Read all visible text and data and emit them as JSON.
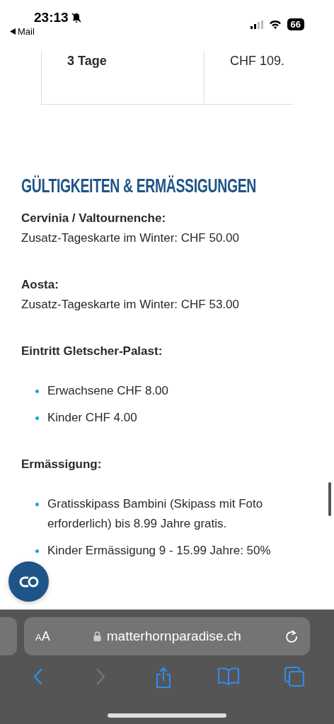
{
  "status_bar": {
    "time": "23:13",
    "back_label": "Mail",
    "battery": "66"
  },
  "table": {
    "rows": [
      {
        "cells": [
          "3 Tage",
          "CHF 109."
        ]
      }
    ]
  },
  "heading": "GÜLTIGKEITEN & ERMÄSSIGUNGEN",
  "sections": [
    {
      "title": "Cervinia / Valtournenche:",
      "kind": "text",
      "text": "Zusatz-Tageskarte im Winter: CHF 50.00"
    },
    {
      "title": "Aosta:",
      "kind": "text",
      "text": "Zusatz-Tageskarte im Winter: CHF 53.00"
    },
    {
      "title": "Eintritt Gletscher-Palast:",
      "kind": "list",
      "items": [
        "Erwachsene CHF 8.00",
        "Kinder CHF 4.00"
      ]
    },
    {
      "title": "Ermässigung:",
      "kind": "list",
      "items": [
        "Gratisskipass Bambini (Skipass mit Foto erforderlich) bis 8.99 Jahre gratis.",
        "Kinder Ermässigung 9 - 15.99 Jahre: 50%"
      ]
    }
  ],
  "browser": {
    "text_size": "AA",
    "url": "matterhornparadise.ch"
  }
}
